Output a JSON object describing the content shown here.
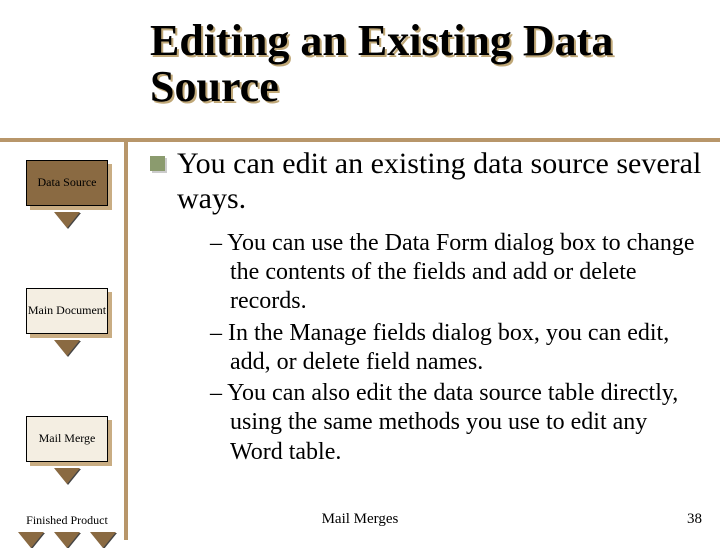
{
  "title": "Editing an Existing Data Source",
  "sidebar": {
    "items": [
      {
        "label": "Data\nSource"
      },
      {
        "label": "Main\nDocument"
      },
      {
        "label": "Mail\nMerge"
      },
      {
        "label": "Finished\nProduct"
      }
    ]
  },
  "content": {
    "bullet": "You can edit an existing data source several ways.",
    "subitems": [
      "– You can use the Data Form dialog box to change the contents of the fields and add or delete records.",
      "– In the Manage fields dialog box, you can edit, add, or delete field names.",
      "– You can also edit the data source table directly, using the same methods you use to edit any Word table."
    ]
  },
  "footer": {
    "center": "Mail Merges",
    "page": "38"
  }
}
